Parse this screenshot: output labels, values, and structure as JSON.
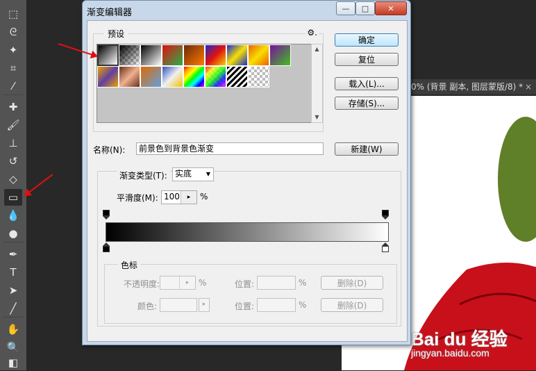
{
  "toolbar": {
    "tools": [
      {
        "name": "marquee-tool-icon",
        "glyph": "⬚"
      },
      {
        "name": "lasso-tool-icon",
        "glyph": "ᘓ"
      },
      {
        "name": "magic-wand-tool-icon",
        "glyph": "✦"
      },
      {
        "name": "crop-tool-icon",
        "glyph": "⌗"
      },
      {
        "name": "eyedropper-tool-icon",
        "glyph": "⁄"
      },
      {
        "name": "healing-brush-tool-icon",
        "glyph": "✚"
      },
      {
        "name": "brush-tool-icon",
        "glyph": "🖌"
      },
      {
        "name": "clone-stamp-tool-icon",
        "glyph": "⊥"
      },
      {
        "name": "history-brush-tool-icon",
        "glyph": "↺"
      },
      {
        "name": "eraser-tool-icon",
        "glyph": "◇"
      },
      {
        "name": "gradient-tool-icon",
        "glyph": "▭"
      },
      {
        "name": "blur-tool-icon",
        "glyph": "💧"
      },
      {
        "name": "dodge-tool-icon",
        "glyph": "●"
      },
      {
        "name": "pen-tool-icon",
        "glyph": "✒"
      },
      {
        "name": "type-tool-icon",
        "glyph": "T"
      },
      {
        "name": "path-selection-tool-icon",
        "glyph": "➤"
      },
      {
        "name": "line-tool-icon",
        "glyph": "╱"
      },
      {
        "name": "hand-tool-icon",
        "glyph": "✋"
      },
      {
        "name": "zoom-tool-icon",
        "glyph": "🔍"
      },
      {
        "name": "color-swatches-icon",
        "glyph": "◧"
      }
    ]
  },
  "document": {
    "tab_title": "0% (背景 副本, 图层蒙版/8) *",
    "close_glyph": "×",
    "watermark": "Bai du 经验",
    "watermark_url": "jingyan.baidu.com"
  },
  "dialog": {
    "title": "渐变编辑器",
    "window_buttons": {
      "minimize": "—",
      "maximize": "□",
      "close": "✕"
    },
    "presets_label": "预设",
    "gear_glyph": "⚙.",
    "buttons": {
      "ok": "确定",
      "reset": "复位",
      "load": "载入(L)...",
      "save": "存储(S)...",
      "new": "新建(W)"
    },
    "name_label": "名称(N):",
    "name_value": "前景色到背景色渐变",
    "gradient_type_label": "渐变类型(T):",
    "gradient_type_value": "实底",
    "smoothness_label": "平滑度(M):",
    "smoothness_value": "100",
    "percent": "%",
    "stops_label": "色标",
    "opacity_label": "不透明度:",
    "location_label": "位置:",
    "delete_label": "删除(D)",
    "color_label": "颜色:",
    "scroll_up": "▲",
    "scroll_down": "▼",
    "dropdown_arrow": "▼",
    "stepper_arrow": "▸"
  }
}
